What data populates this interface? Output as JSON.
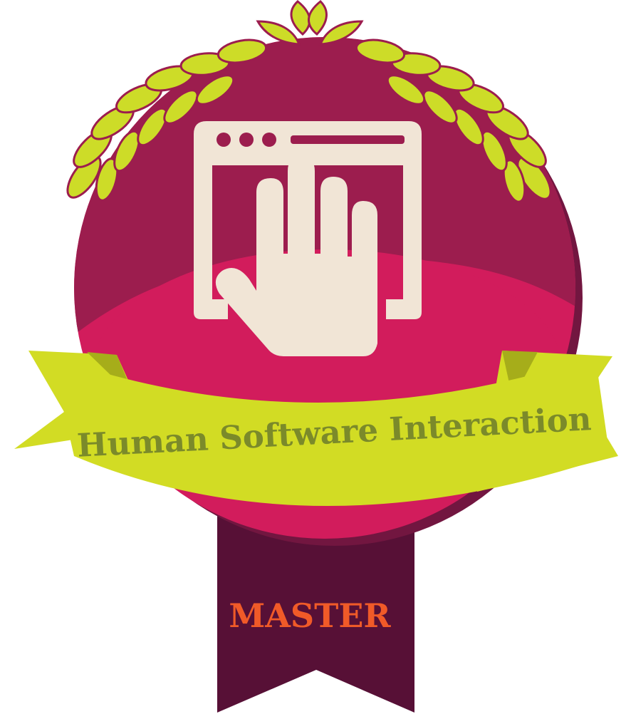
{
  "badge": {
    "title": "Human Software Interaction",
    "level": "MASTER",
    "icon": "browser-window-hand-icon"
  },
  "colors": {
    "medal_dark": "#9c1d4e",
    "medal_light": "#d21c5c",
    "medal_shadow": "#721640",
    "tail_ribbon": "#571036",
    "banner": "#d2dc24",
    "banner_shade": "#a6ad1a",
    "leaf": "#cddc28",
    "title_text": "#7b8a2a",
    "level_text": "#f05a28",
    "icon": "#f1e5d6"
  }
}
